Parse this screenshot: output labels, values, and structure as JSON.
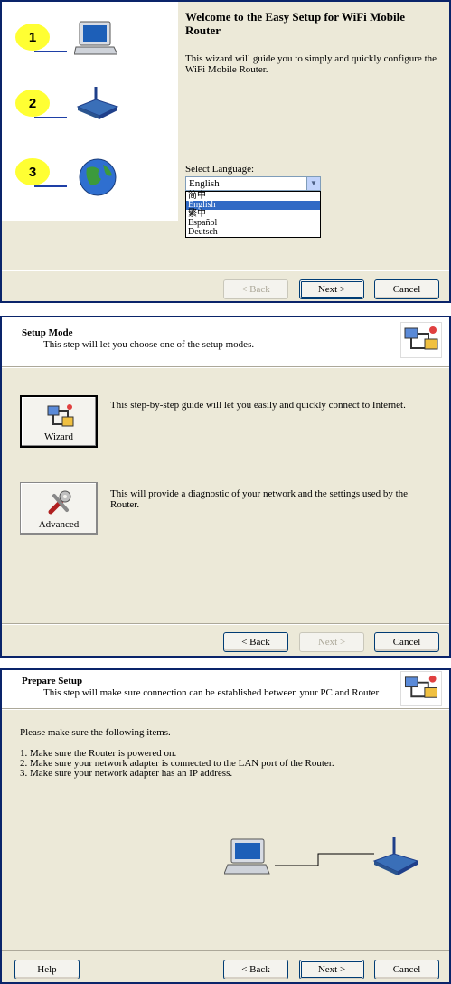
{
  "welcome": {
    "steps": [
      "1",
      "2",
      "3"
    ],
    "title": "Welcome to the Easy Setup for WiFi Mobile Router",
    "description": "This wizard will guide you to simply and quickly configure the WiFi Mobile Router.",
    "select_language_label": "Select Language:",
    "selected_language": "English",
    "language_options": [
      "简中",
      "English",
      "繁中",
      "Español",
      "Deutsch"
    ],
    "buttons": {
      "back": "< Back",
      "next": "Next >",
      "cancel": "Cancel"
    }
  },
  "setup_mode": {
    "title": "Setup Mode",
    "subtitle": "This step will let you choose one of the setup modes.",
    "wizard_label": "Wizard",
    "wizard_desc": "This step-by-step guide will let you easily and quickly connect to Internet.",
    "advanced_label": "Advanced",
    "advanced_desc": "This will provide a diagnostic of your network and the settings used by the Router.",
    "buttons": {
      "back": "< Back",
      "next": "Next >",
      "cancel": "Cancel"
    }
  },
  "prepare_setup": {
    "title": "Prepare Setup",
    "subtitle": "This step will make sure connection can be established between your PC and Router",
    "intro": "Please make sure the following items.",
    "items": [
      "1. Make sure the Router is powered on.",
      "2. Make sure your network adapter is connected to the LAN port of the Router.",
      "3. Make sure your network adapter has an IP address."
    ],
    "buttons": {
      "help": "Help",
      "back": "< Back",
      "next": "Next >",
      "cancel": "Cancel"
    }
  },
  "colors": {
    "selection": "#316ac5",
    "window_bg": "#ece9d8",
    "step_circle": "#ffff33",
    "router_blue": "#3a6fb8"
  }
}
